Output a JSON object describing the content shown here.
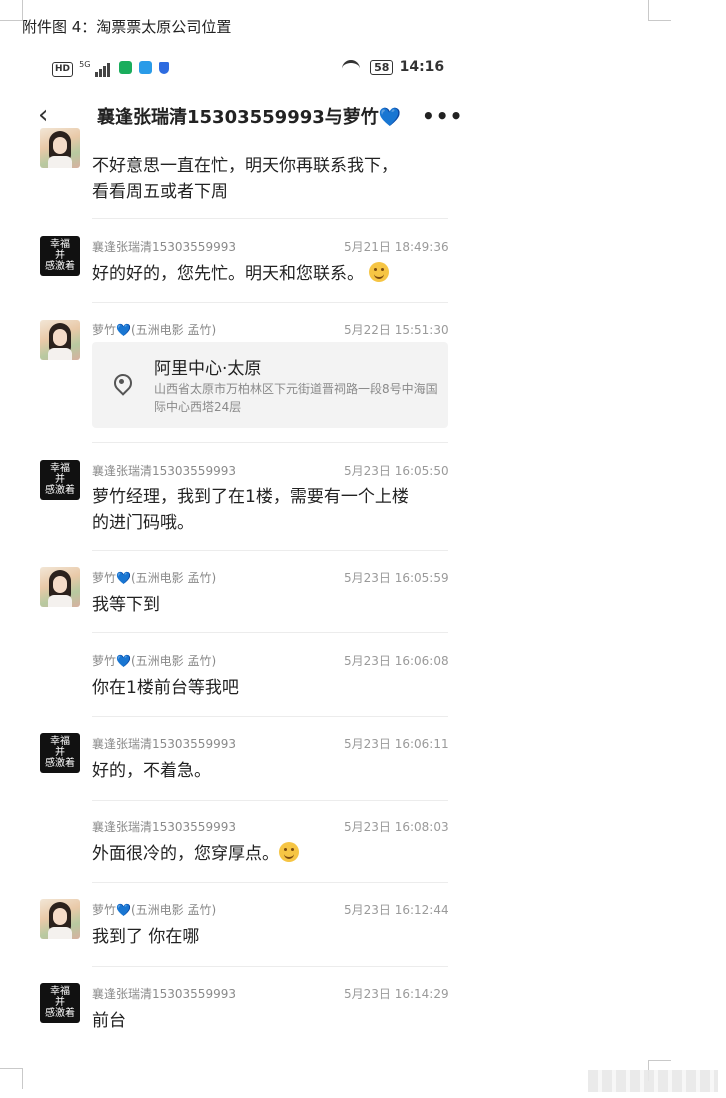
{
  "document": {
    "caption": "附件图 4：淘票票太原公司位置"
  },
  "status_bar": {
    "left_label": "HD",
    "network": "5G",
    "battery": "58",
    "time": "14:16"
  },
  "chat_header": {
    "title": "襄逢张瑞清15303559993与萝竹",
    "more_label": "•••"
  },
  "avatars": {
    "dark_text": [
      "幸福",
      "并",
      "感激着"
    ]
  },
  "messages": [
    {
      "text_line1": "不好意思一直在忙，明天你再联系我下，",
      "text_line2": "看看周五或者下周"
    },
    {
      "sender": "襄逢张瑞清15303559993",
      "time": "5月21日 18:49:36",
      "text": "好的好的，您先忙。明天和您联系。"
    },
    {
      "sender": "萝竹",
      "sender_suffix": "(五洲电影 孟竹)",
      "time": "5月22日 15:51:30",
      "location_title": "阿里中心·太原",
      "location_addr": "山西省太原市万柏林区下元街道晋祠路一段8号中海国际中心西塔24层"
    },
    {
      "sender": "襄逢张瑞清15303559993",
      "time": "5月23日 16:05:50",
      "text_line1": "萝竹经理，我到了在1楼，需要有一个上楼",
      "text_line2": "的进门码哦。"
    },
    {
      "sender": "萝竹",
      "sender_suffix": "(五洲电影 孟竹)",
      "time": "5月23日 16:05:59",
      "text": "我等下到"
    },
    {
      "sender": "萝竹",
      "sender_suffix": "(五洲电影 孟竹)",
      "time": "5月23日 16:06:08",
      "text": "你在1楼前台等我吧"
    },
    {
      "sender": "襄逢张瑞清15303559993",
      "time": "5月23日 16:06:11",
      "text": "好的，不着急。"
    },
    {
      "sender": "襄逢张瑞清15303559993",
      "time": "5月23日 16:08:03",
      "text": "外面很冷的，您穿厚点。"
    },
    {
      "sender": "萝竹",
      "sender_suffix": "(五洲电影 孟竹)",
      "time": "5月23日 16:12:44",
      "text": "我到了 你在哪"
    },
    {
      "sender": "襄逢张瑞清15303559993",
      "time": "5月23日 16:14:29",
      "text": "前台"
    }
  ],
  "icons": {
    "back": "chevron-left-icon",
    "more": "more-icon",
    "heart": "💙"
  }
}
